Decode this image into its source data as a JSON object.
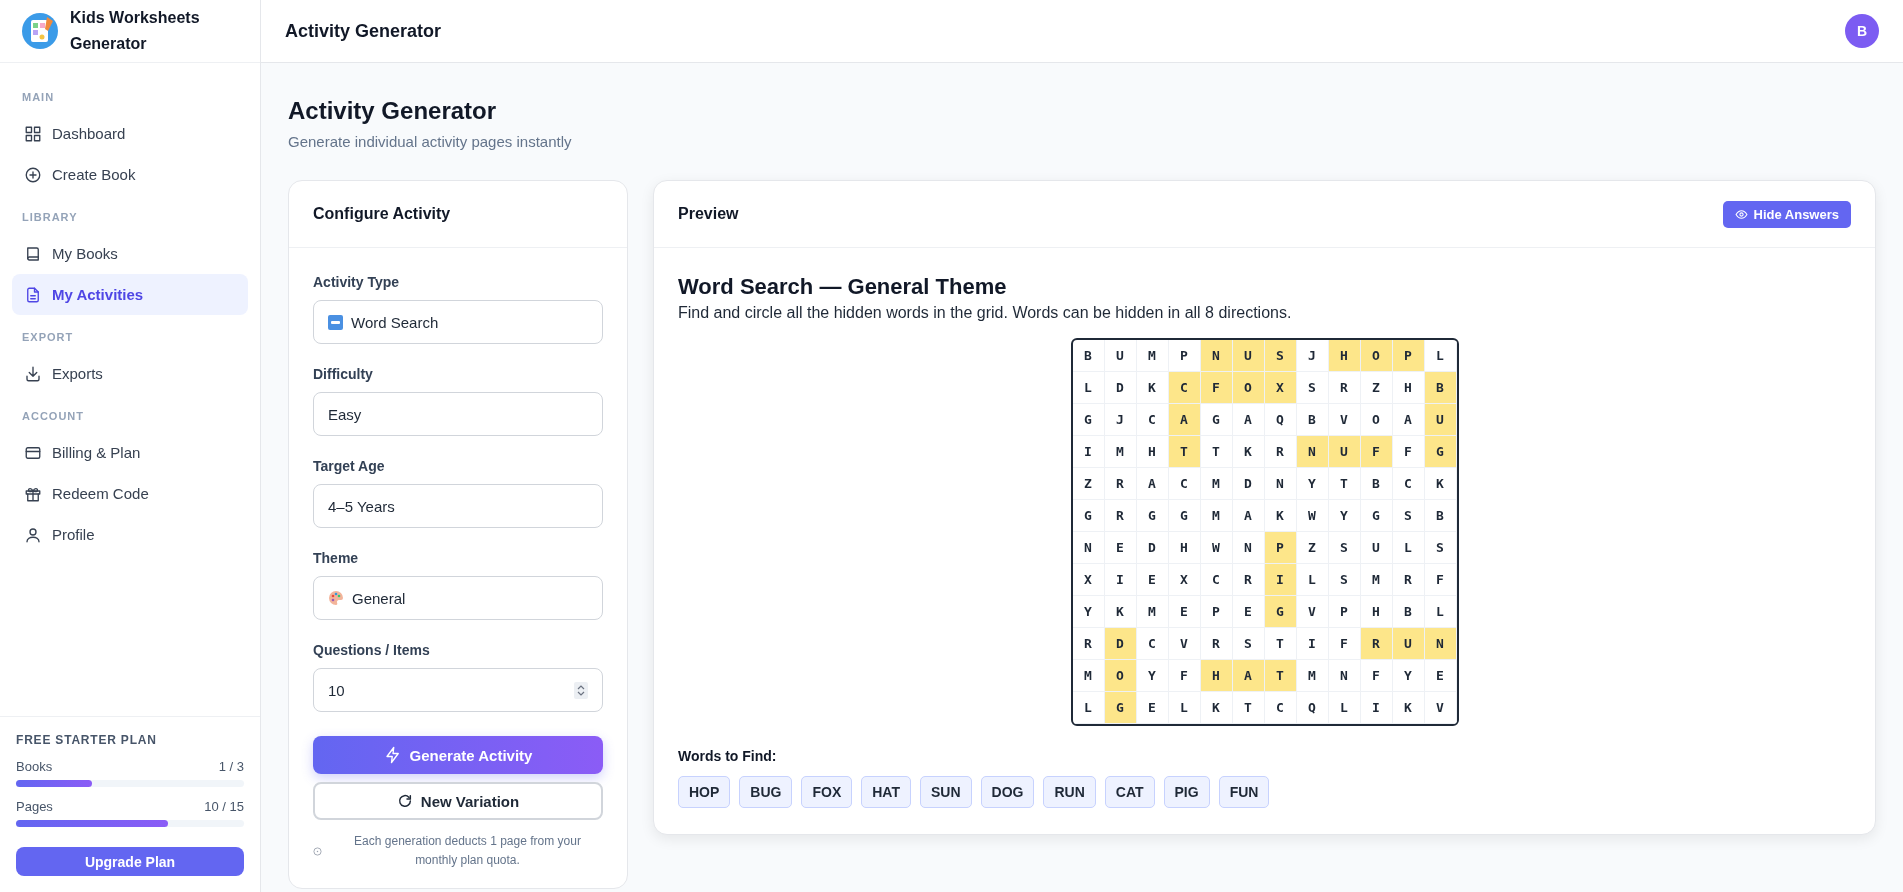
{
  "app": {
    "name": "Kids Worksheets Generator"
  },
  "sidebar": {
    "sections": [
      {
        "label": "MAIN",
        "items": [
          {
            "label": "Dashboard",
            "selected": false
          },
          {
            "label": "Create Book",
            "selected": false
          }
        ]
      },
      {
        "label": "LIBRARY",
        "items": [
          {
            "label": "My Books",
            "selected": false
          },
          {
            "label": "My Activities",
            "selected": true
          }
        ]
      },
      {
        "label": "EXPORT",
        "items": [
          {
            "label": "Exports",
            "selected": false
          }
        ]
      },
      {
        "label": "ACCOUNT",
        "items": [
          {
            "label": "Billing & Plan",
            "selected": false
          },
          {
            "label": "Redeem Code",
            "selected": false
          },
          {
            "label": "Profile",
            "selected": false
          }
        ]
      }
    ],
    "plan": {
      "title": "FREE STARTER PLAN",
      "meters": [
        {
          "label": "Books",
          "reading": "1 / 3",
          "level": 0.333
        },
        {
          "label": "Pages",
          "reading": "10 / 15",
          "level": 0.667
        }
      ],
      "button": "Upgrade Plan"
    }
  },
  "topbar": {
    "title": "Activity Generator",
    "avatar": "B"
  },
  "page": {
    "title": "Activity Generator",
    "subtitle": "Generate individual activity pages instantly"
  },
  "config": {
    "title": "Configure Activity",
    "fields": [
      {
        "label": "Activity Type",
        "value": "Word Search",
        "kind": "select"
      },
      {
        "label": "Difficulty",
        "value": "Easy",
        "kind": "select"
      },
      {
        "label": "Target Age",
        "value": "4–5 Years",
        "kind": "select"
      },
      {
        "label": "Theme",
        "value": "General",
        "kind": "select"
      },
      {
        "label": "Questions / Items",
        "value": "10",
        "kind": "number"
      }
    ],
    "generate_button": "Generate Activity",
    "variation_button": "New Variation",
    "note": "Each generation deducts 1 page from your monthly plan quota."
  },
  "preview": {
    "title": "Preview",
    "answers_button": "Hide Answers",
    "heading": "Word Search — General Theme",
    "instructions": "Find and circle all the hidden words in the grid. Words can be hidden in all 8 directions.",
    "grid": [
      {
        "cells": [
          "B",
          "U",
          "M",
          "P",
          "N",
          "U",
          "S",
          "J",
          "H",
          "O",
          "P",
          "L"
        ],
        "highlighted": [
          false,
          false,
          false,
          false,
          true,
          true,
          true,
          false,
          true,
          true,
          true,
          false
        ]
      },
      {
        "cells": [
          "L",
          "D",
          "K",
          "C",
          "F",
          "O",
          "X",
          "S",
          "R",
          "Z",
          "H",
          "B"
        ],
        "highlighted": [
          false,
          false,
          false,
          true,
          true,
          true,
          true,
          false,
          false,
          false,
          false,
          true
        ]
      },
      {
        "cells": [
          "G",
          "J",
          "C",
          "A",
          "G",
          "A",
          "Q",
          "B",
          "V",
          "O",
          "A",
          "U"
        ],
        "highlighted": [
          false,
          false,
          false,
          true,
          false,
          false,
          false,
          false,
          false,
          false,
          false,
          true
        ]
      },
      {
        "cells": [
          "I",
          "M",
          "H",
          "T",
          "T",
          "K",
          "R",
          "N",
          "U",
          "F",
          "F",
          "G"
        ],
        "highlighted": [
          false,
          false,
          false,
          true,
          false,
          false,
          false,
          true,
          true,
          true,
          false,
          true
        ]
      },
      {
        "cells": [
          "Z",
          "R",
          "A",
          "C",
          "M",
          "D",
          "N",
          "Y",
          "T",
          "B",
          "C",
          "K"
        ],
        "highlighted": [
          false,
          false,
          false,
          false,
          false,
          false,
          false,
          false,
          false,
          false,
          false,
          false
        ]
      },
      {
        "cells": [
          "G",
          "R",
          "G",
          "G",
          "M",
          "A",
          "K",
          "W",
          "Y",
          "G",
          "S",
          "B"
        ],
        "highlighted": [
          false,
          false,
          false,
          false,
          false,
          false,
          false,
          false,
          false,
          false,
          false,
          false
        ]
      },
      {
        "cells": [
          "N",
          "E",
          "D",
          "H",
          "W",
          "N",
          "P",
          "Z",
          "S",
          "U",
          "L",
          "S"
        ],
        "highlighted": [
          false,
          false,
          false,
          false,
          false,
          false,
          true,
          false,
          false,
          false,
          false,
          false
        ]
      },
      {
        "cells": [
          "X",
          "I",
          "E",
          "X",
          "C",
          "R",
          "I",
          "L",
          "S",
          "M",
          "R",
          "F"
        ],
        "highlighted": [
          false,
          false,
          false,
          false,
          false,
          false,
          true,
          false,
          false,
          false,
          false,
          false
        ]
      },
      {
        "cells": [
          "Y",
          "K",
          "M",
          "E",
          "P",
          "E",
          "G",
          "V",
          "P",
          "H",
          "B",
          "L"
        ],
        "highlighted": [
          false,
          false,
          false,
          false,
          false,
          false,
          true,
          false,
          false,
          false,
          false,
          false
        ]
      },
      {
        "cells": [
          "R",
          "D",
          "C",
          "V",
          "R",
          "S",
          "T",
          "I",
          "F",
          "R",
          "U",
          "N"
        ],
        "highlighted": [
          false,
          true,
          false,
          false,
          false,
          false,
          false,
          false,
          false,
          true,
          true,
          true
        ]
      },
      {
        "cells": [
          "M",
          "O",
          "Y",
          "F",
          "H",
          "A",
          "T",
          "M",
          "N",
          "F",
          "Y",
          "E"
        ],
        "highlighted": [
          false,
          true,
          false,
          false,
          true,
          true,
          true,
          false,
          false,
          false,
          false,
          false
        ]
      },
      {
        "cells": [
          "L",
          "G",
          "E",
          "L",
          "K",
          "T",
          "C",
          "Q",
          "L",
          "I",
          "K",
          "V"
        ],
        "highlighted": [
          false,
          true,
          false,
          false,
          false,
          false,
          false,
          false,
          false,
          false,
          false,
          false
        ]
      }
    ],
    "words_title": "Words to Find:",
    "words": [
      "HOP",
      "BUG",
      "FOX",
      "HAT",
      "SUN",
      "DOG",
      "RUN",
      "CAT",
      "PIG",
      "FUN"
    ]
  }
}
